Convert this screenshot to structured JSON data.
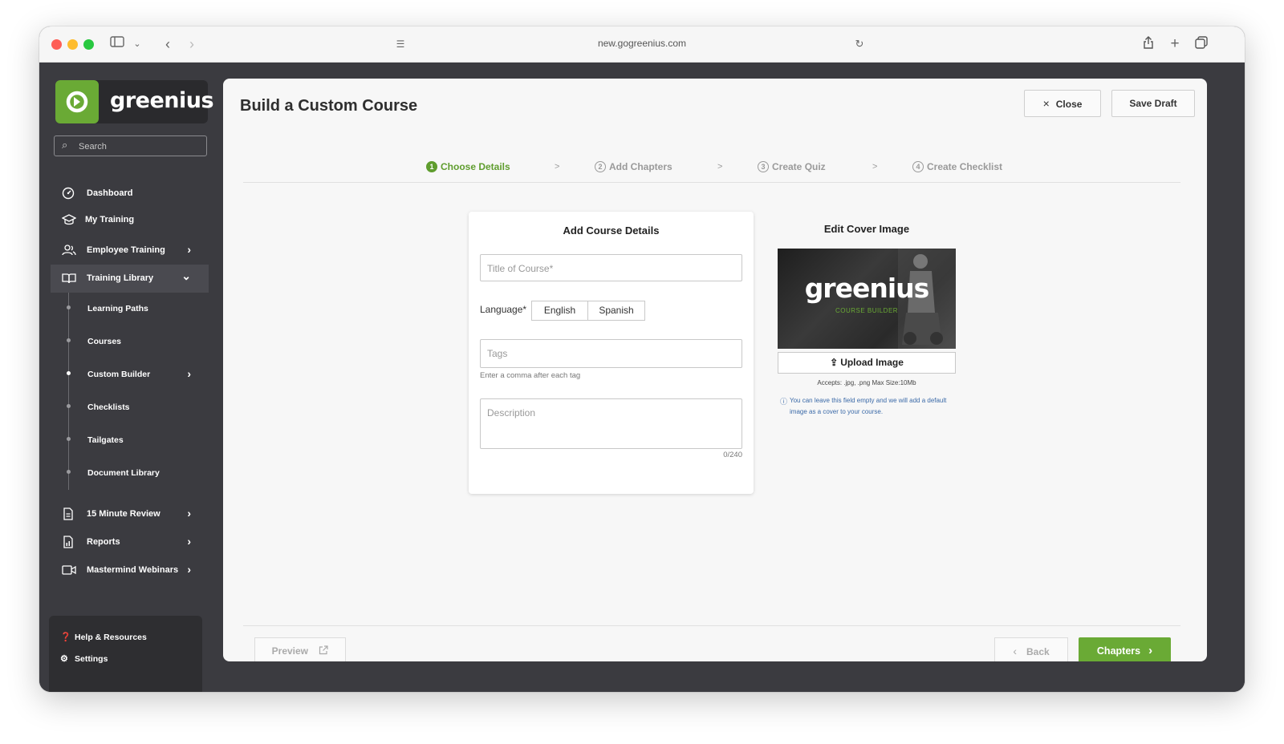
{
  "browser": {
    "url": "new.gogreenius.com"
  },
  "brand": {
    "logo_text": "greenius",
    "accent": "#6aaa35"
  },
  "sidebar": {
    "search_placeholder": "Search",
    "items": [
      {
        "label": "Dashboard",
        "icon": "dashboard-icon"
      },
      {
        "label": "My Training",
        "icon": "graduation-cap-icon"
      },
      {
        "label": "Employee Training",
        "icon": "users-icon"
      },
      {
        "label": "Training Library",
        "icon": "book-icon"
      }
    ],
    "library_subitems": [
      {
        "label": "Learning Paths"
      },
      {
        "label": "Courses"
      },
      {
        "label": "Custom Builder"
      },
      {
        "label": "Checklists"
      },
      {
        "label": "Tailgates"
      },
      {
        "label": "Document Library"
      }
    ],
    "lower_items": [
      {
        "label": "15 Minute Review",
        "icon": "document-icon"
      },
      {
        "label": "Reports",
        "icon": "report-icon"
      },
      {
        "label": "Mastermind Webinars",
        "icon": "video-icon"
      }
    ],
    "help": {
      "label": "Help & Resources"
    },
    "settings": {
      "label": "Settings"
    }
  },
  "main": {
    "title": "Build a Custom Course",
    "close_label": "Close",
    "save_draft_label": "Save Draft",
    "steps": [
      {
        "num": "1",
        "label": "Choose Details"
      },
      {
        "num": "2",
        "label": "Add Chapters"
      },
      {
        "num": "3",
        "label": "Create Quiz"
      },
      {
        "num": "4",
        "label": "Create Checklist"
      }
    ],
    "step_separator": ">",
    "details": {
      "title": "Add Course Details",
      "course_title_placeholder": "Title of Course*",
      "language_label": "Language*",
      "language_options": [
        "English",
        "Spanish"
      ],
      "tags_placeholder": "Tags",
      "tags_hint": "Enter a comma after each tag",
      "description_placeholder": "Description",
      "char_count": "0/240"
    },
    "cover": {
      "title": "Edit Cover Image",
      "image_brand": "greenius",
      "image_subtitle": "COURSE BUILDER",
      "upload_label": "Upload Image",
      "accepts": "Accepts: .jpg, .png Max Size:10Mb",
      "info": "You can leave this field empty and we will add a default image as a cover to your course."
    },
    "footer": {
      "preview_label": "Preview",
      "back_label": "Back",
      "next_label": "Chapters"
    }
  }
}
